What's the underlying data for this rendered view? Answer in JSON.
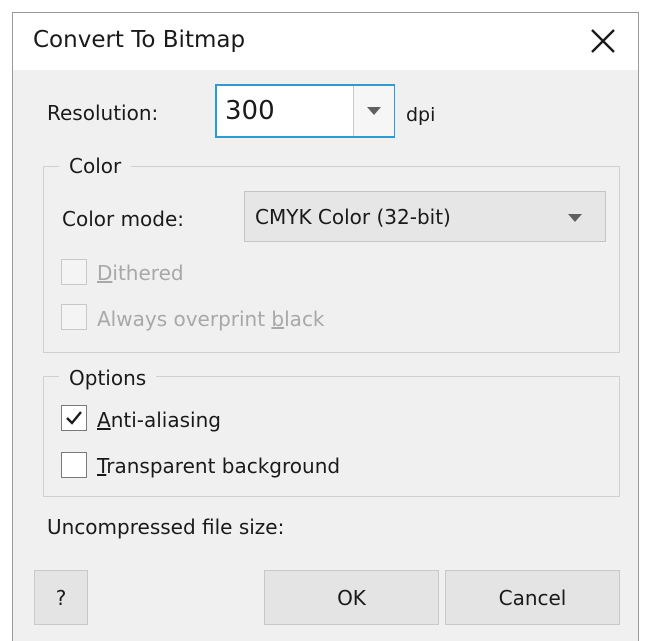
{
  "dialog": {
    "title": "Convert To Bitmap",
    "close_icon": "close-icon"
  },
  "resolution": {
    "label": "Resolution:",
    "value": "300",
    "unit": "dpi",
    "dropdown_icon": "triangle-down-icon"
  },
  "color_group": {
    "legend": "Color",
    "mode_label": "Color mode:",
    "mode_value": "CMYK Color (32-bit)",
    "dithered": {
      "pre": "",
      "key": "D",
      "post": "ithered",
      "checked": false,
      "disabled": true
    },
    "overprint": {
      "pre": "Always overprint ",
      "key": "b",
      "post": "lack",
      "checked": false,
      "disabled": true
    }
  },
  "options_group": {
    "legend": "Options",
    "antialias": {
      "pre": "",
      "key": "A",
      "post": "nti-aliasing",
      "checked": true
    },
    "transparent": {
      "pre": "",
      "key": "T",
      "post": "ransparent background",
      "checked": false
    }
  },
  "file_size_label": "Uncompressed file size:",
  "buttons": {
    "help": "?",
    "ok": "OK",
    "cancel": "Cancel"
  },
  "colors": {
    "focus_border": "#2b9bd8",
    "dialog_bg": "#f0f0f0",
    "disabled_text": "#a8a8a8"
  }
}
